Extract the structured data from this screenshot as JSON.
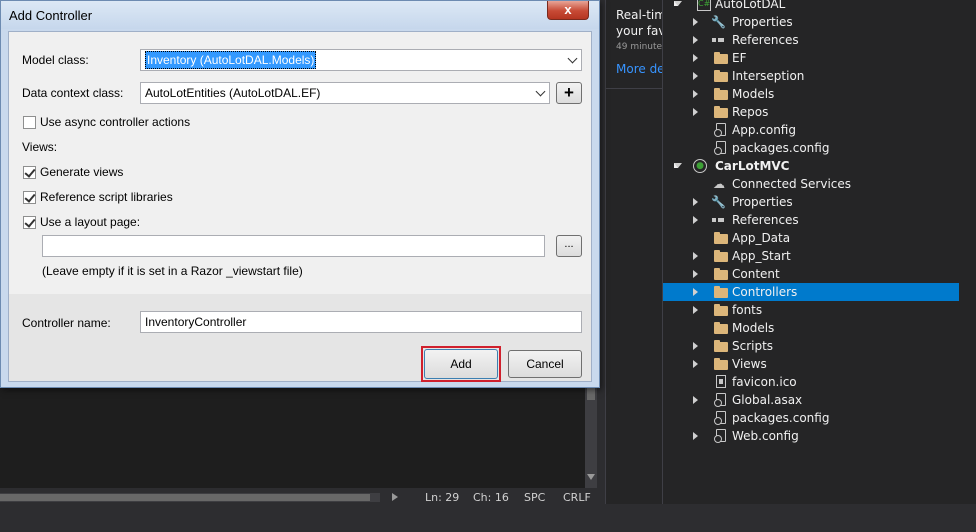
{
  "editor": {
    "status": {
      "line": "Ln: 29",
      "col": "Ch: 16",
      "mode": "SPC",
      "eol": "CRLF"
    }
  },
  "notifications": {
    "line1": "Real-tim",
    "line2": "your fav",
    "time": "49 minute(",
    "link": "More de"
  },
  "solution_explorer": {
    "items": [
      {
        "label": "AutoLotDAL",
        "icon": "csharp-project-icon"
      },
      {
        "label": "Properties",
        "icon": "wrench-icon"
      },
      {
        "label": "References",
        "icon": "references-icon"
      },
      {
        "label": "EF",
        "icon": "folder-icon"
      },
      {
        "label": "Interseption",
        "icon": "folder-icon"
      },
      {
        "label": "Models",
        "icon": "folder-icon"
      },
      {
        "label": "Repos",
        "icon": "folder-icon"
      },
      {
        "label": "App.config",
        "icon": "config-file-icon"
      },
      {
        "label": "packages.config",
        "icon": "config-file-icon"
      },
      {
        "label": "CarLotMVC",
        "icon": "web-project-icon"
      },
      {
        "label": "Connected Services",
        "icon": "cloud-icon"
      },
      {
        "label": "Properties",
        "icon": "wrench-icon"
      },
      {
        "label": "References",
        "icon": "references-icon"
      },
      {
        "label": "App_Data",
        "icon": "folder-icon"
      },
      {
        "label": "App_Start",
        "icon": "folder-icon"
      },
      {
        "label": "Content",
        "icon": "folder-icon"
      },
      {
        "label": "Controllers",
        "icon": "folder-icon"
      },
      {
        "label": "fonts",
        "icon": "folder-icon"
      },
      {
        "label": "Models",
        "icon": "folder-icon"
      },
      {
        "label": "Scripts",
        "icon": "folder-icon"
      },
      {
        "label": "Views",
        "icon": "folder-icon"
      },
      {
        "label": "favicon.ico",
        "icon": "file-icon"
      },
      {
        "label": "Global.asax",
        "icon": "config-file-icon"
      },
      {
        "label": "packages.config",
        "icon": "config-file-icon"
      },
      {
        "label": "Web.config",
        "icon": "config-file-icon"
      }
    ],
    "selected": "Controllers",
    "selection_color": "#007acc"
  },
  "dialog": {
    "title": "Add Controller",
    "close_label": "x",
    "model_class_label": "Model class:",
    "model_class_value": "Inventory (AutoLotDAL.Models)",
    "data_context_label": "Data context class:",
    "data_context_value": "AutoLotEntities (AutoLotDAL.EF)",
    "add_context_button": "+",
    "async_label": "Use async controller actions",
    "async_checked": false,
    "views_label": "Views:",
    "generate_views_label": "Generate views",
    "generate_views_checked": true,
    "reference_scripts_label": "Reference script libraries",
    "reference_scripts_checked": true,
    "layout_page_label": "Use a layout page:",
    "layout_page_checked": true,
    "layout_path_value": "",
    "browse_button": "...",
    "layout_hint": "(Leave empty if it is set in a Razor _viewstart file)",
    "controller_name_label": "Controller name:",
    "controller_name_value": "InventoryController",
    "add_button": "Add",
    "cancel_button": "Cancel",
    "highlight_color": "#d0202d"
  }
}
